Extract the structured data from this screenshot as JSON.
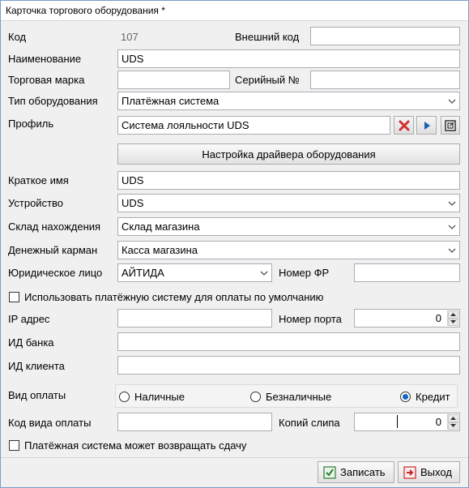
{
  "window": {
    "title": "Карточка торгового оборудования *"
  },
  "form": {
    "code_label": "Код",
    "code_value": "107",
    "external_code_label": "Внешний код",
    "external_code_value": "",
    "name_label": "Наименование",
    "name_value": "UDS",
    "brand_label": "Торговая марка",
    "brand_value": "",
    "serial_label": "Серийный №",
    "serial_value": "",
    "equipment_type_label": "Тип оборудования",
    "equipment_type_value": "Платёжная система",
    "profile_label": "Профиль",
    "profile_value": "Система лояльности UDS",
    "driver_settings_label": "Настройка драйвера оборудования",
    "short_name_label": "Краткое имя",
    "short_name_value": "UDS",
    "device_label": "Устройство",
    "device_value": "UDS",
    "warehouse_label": "Склад нахождения",
    "warehouse_value": "Склад магазина",
    "cash_pocket_label": "Денежный карман",
    "cash_pocket_value": "Касса магазина",
    "legal_entity_label": "Юридическое лицо",
    "legal_entity_value": "АЙТИДА",
    "fr_number_label": "Номер ФР",
    "fr_number_value": "",
    "default_payment_label": "Использовать платёжную систему для оплаты по умолчанию",
    "ip_label": "IP адрес",
    "ip_value": "",
    "port_label": "Номер порта",
    "port_value": "0",
    "bank_id_label": "ИД банка",
    "bank_id_value": "",
    "client_id_label": "ИД клиента",
    "client_id_value": "",
    "payment_type_label": "Вид оплаты",
    "payment_options": [
      "Наличные",
      "Безналичные",
      "Кредит"
    ],
    "payment_selected": "Кредит",
    "payment_code_label": "Код вида оплаты",
    "payment_code_value": "",
    "slip_copies_label": "Копий слипа",
    "slip_copies_value": "0",
    "return_change_label": "Платёжная система может возвращать сдачу"
  },
  "footer": {
    "save_label": "Записать",
    "exit_label": "Выход"
  },
  "colors": {
    "radio_selected": "#1565c0",
    "clear_icon": "#d32f2f",
    "arrow_icon": "#1e5fb4"
  }
}
